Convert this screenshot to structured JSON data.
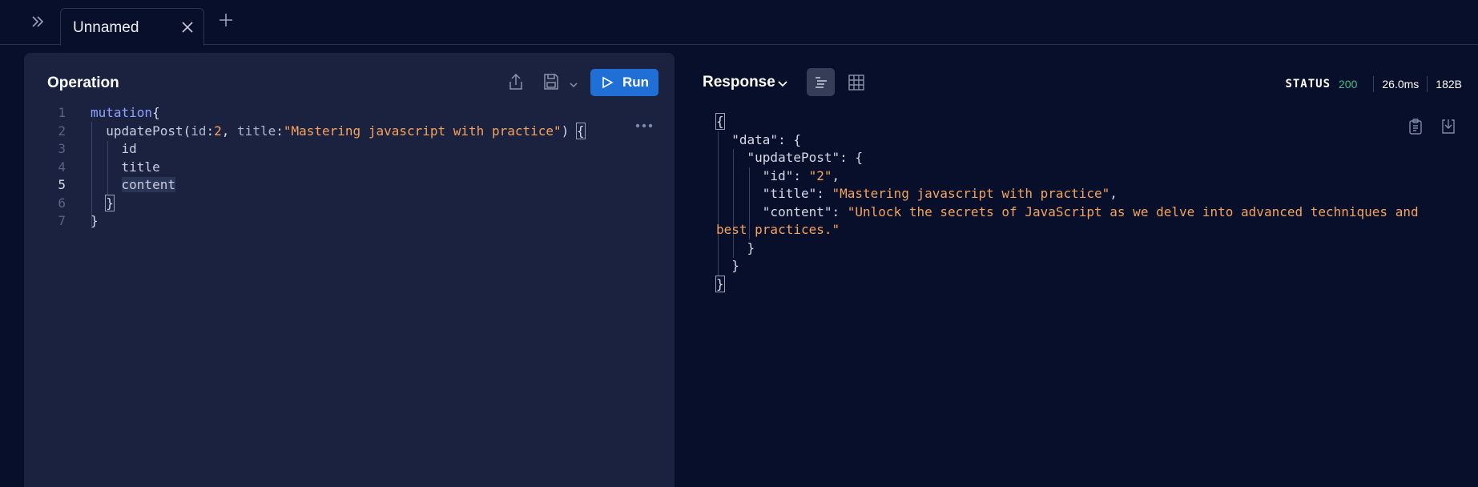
{
  "tabs": {
    "active_label": "Unnamed"
  },
  "operation": {
    "title": "Operation",
    "run_label": "Run",
    "lines": [
      {
        "n": "1",
        "tokens": [
          {
            "t": "mutation",
            "c": "kw"
          },
          {
            "t": "{",
            "c": "pl"
          }
        ]
      },
      {
        "n": "2",
        "tokens": [
          {
            "t": "  updatePost",
            "c": "fn"
          },
          {
            "t": "(",
            "c": "pl"
          },
          {
            "t": "id",
            "c": "arg"
          },
          {
            "t": ":",
            "c": "pl"
          },
          {
            "t": "2",
            "c": "num"
          },
          {
            "t": ", ",
            "c": "pl"
          },
          {
            "t": "title",
            "c": "arg"
          },
          {
            "t": ":",
            "c": "pl"
          },
          {
            "t": "\"Mastering javascript with practice\"",
            "c": "str"
          },
          {
            "t": ") ",
            "c": "pl"
          },
          {
            "t": "{",
            "c": "pl brace-hl"
          }
        ]
      },
      {
        "n": "3",
        "tokens": [
          {
            "t": "    id",
            "c": "fn"
          }
        ]
      },
      {
        "n": "4",
        "tokens": [
          {
            "t": "    title",
            "c": "fn"
          }
        ]
      },
      {
        "n": "5",
        "tokens": [
          {
            "t": "    ",
            "c": "pl"
          },
          {
            "t": "content",
            "c": "fn sel"
          }
        ],
        "active": true
      },
      {
        "n": "6",
        "tokens": [
          {
            "t": "  ",
            "c": "pl"
          },
          {
            "t": "}",
            "c": "pl brace-hl"
          }
        ]
      },
      {
        "n": "7",
        "tokens": [
          {
            "t": "}",
            "c": "pl"
          }
        ]
      }
    ]
  },
  "response": {
    "title": "Response",
    "status_label": "STATUS",
    "status_code": "200",
    "time": "26.0ms",
    "size": "182B",
    "lines": [
      {
        "tokens": [
          {
            "t": "{",
            "c": "jk brace-hl"
          }
        ]
      },
      {
        "tokens": [
          {
            "t": "  \"data\"",
            "c": "jk"
          },
          {
            "t": ": {",
            "c": "jk"
          }
        ]
      },
      {
        "tokens": [
          {
            "t": "    \"updatePost\"",
            "c": "jk"
          },
          {
            "t": ": {",
            "c": "jk"
          }
        ]
      },
      {
        "tokens": [
          {
            "t": "      \"id\"",
            "c": "jk"
          },
          {
            "t": ": ",
            "c": "jk"
          },
          {
            "t": "\"2\"",
            "c": "js"
          },
          {
            "t": ",",
            "c": "jk"
          }
        ]
      },
      {
        "tokens": [
          {
            "t": "      \"title\"",
            "c": "jk"
          },
          {
            "t": ": ",
            "c": "jk"
          },
          {
            "t": "\"Mastering javascript with practice\"",
            "c": "js"
          },
          {
            "t": ",",
            "c": "jk"
          }
        ]
      },
      {
        "tokens": [
          {
            "t": "      \"content\"",
            "c": "jk"
          },
          {
            "t": ": ",
            "c": "jk"
          },
          {
            "t": "\"Unlock the secrets of JavaScript as we delve into advanced techniques and",
            "c": "js"
          }
        ]
      },
      {
        "tokens": [
          {
            "t": "best practices.\"",
            "c": "js"
          }
        ]
      },
      {
        "tokens": [
          {
            "t": "    }",
            "c": "jk"
          }
        ]
      },
      {
        "tokens": [
          {
            "t": "  }",
            "c": "jk"
          }
        ]
      },
      {
        "tokens": [
          {
            "t": "}",
            "c": "jk brace-hl"
          }
        ]
      }
    ]
  }
}
